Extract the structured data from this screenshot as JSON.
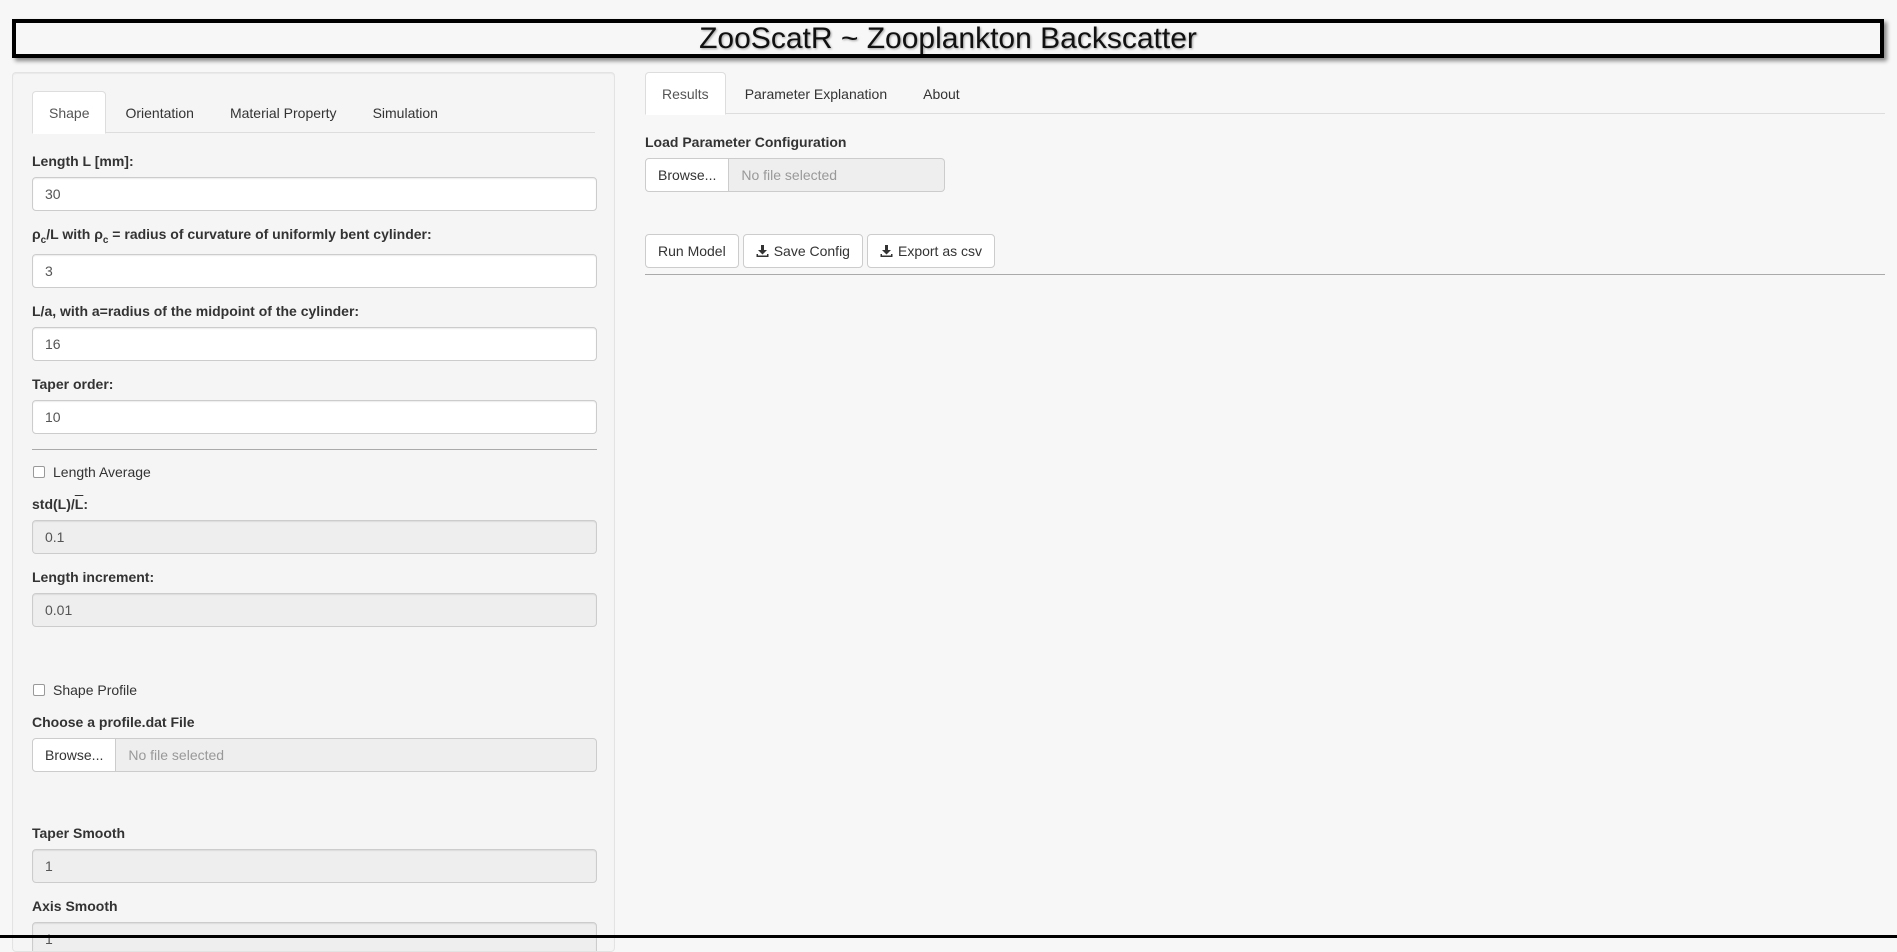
{
  "app": {
    "title": "ZooScatR ~ Zooplankton Backscatter"
  },
  "sidebar": {
    "tabs": [
      {
        "label": "Shape",
        "active": true
      },
      {
        "label": "Orientation",
        "active": false
      },
      {
        "label": "Material Property",
        "active": false
      },
      {
        "label": "Simulation",
        "active": false
      }
    ],
    "length": {
      "label": "Length L [mm]:",
      "value": "30"
    },
    "curvature": {
      "label_part1": "ρ",
      "label_sub1": "c",
      "label_part2": "/L with ρ",
      "label_sub2": "c",
      "label_part3": " = radius of curvature of uniformly bent cylinder:",
      "value": "3"
    },
    "la": {
      "label": "L/a, with a=radius of the midpoint of the cylinder:",
      "value": "16"
    },
    "taper": {
      "label": "Taper order:",
      "value": "10"
    },
    "length_average": {
      "label": "Length Average",
      "checked": false
    },
    "std": {
      "label_prefix": "std(L)/",
      "label_overline": "L",
      "label_suffix": ":",
      "value": "0.1"
    },
    "length_increment": {
      "label": "Length increment:",
      "value": "0.01"
    },
    "shape_profile": {
      "label": "Shape Profile",
      "checked": false
    },
    "profile_file": {
      "label": "Choose a profile.dat File",
      "browse_label": "Browse...",
      "placeholder": "No file selected"
    },
    "taper_smooth": {
      "label": "Taper Smooth",
      "value": "1"
    },
    "axis_smooth": {
      "label": "Axis Smooth",
      "value": "1"
    }
  },
  "main": {
    "tabs": [
      {
        "label": "Results",
        "active": true
      },
      {
        "label": "Parameter Explanation",
        "active": false
      },
      {
        "label": "About",
        "active": false
      }
    ],
    "load_config": {
      "label": "Load Parameter Configuration",
      "browse_label": "Browse...",
      "placeholder": "No file selected"
    },
    "buttons": {
      "run": "Run Model",
      "save": "Save Config",
      "export": "Export as csv"
    },
    "download_icon": "download-icon"
  }
}
